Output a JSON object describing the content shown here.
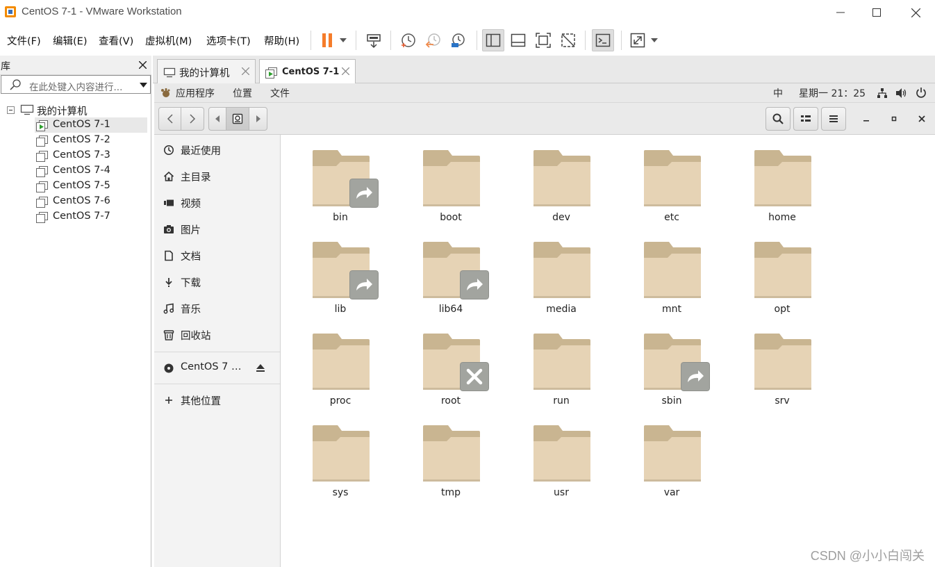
{
  "window": {
    "title": "CentOS 7-1 - VMware Workstation"
  },
  "menu": {
    "items": [
      "文件(F)",
      "编辑(E)",
      "查看(V)",
      "虚拟机(M)",
      "选项卡(T)",
      "帮助(H)"
    ]
  },
  "toolbar": {
    "icons": [
      "pause-icon",
      "dropdown-icon",
      "send-ctrl-alt-del-icon",
      "snapshot-icon",
      "revert-snapshot-icon",
      "snapshot-manager-icon",
      "library-view-icon",
      "thumbnail-view-icon",
      "fullscreen-icon",
      "unity-icon",
      "console-icon",
      "stretch-icon",
      "dropdown-icon"
    ]
  },
  "library": {
    "title": "库",
    "search_placeholder": "在此处键入内容进行...",
    "root": "我的计算机",
    "vms": [
      "CentOS 7-1",
      "CentOS 7-2",
      "CentOS 7-3",
      "CentOS 7-4",
      "CentOS 7-5",
      "CentOS 7-6",
      "CentOS 7-7"
    ],
    "selected": "CentOS 7-1"
  },
  "tabs": [
    {
      "label": "我的计算机",
      "active": false
    },
    {
      "label": "CentOS 7-1",
      "active": true
    }
  ],
  "gnome": {
    "menus": [
      "应用程序",
      "位置",
      "文件"
    ],
    "input_method": "中",
    "clock": "星期一 21：25"
  },
  "sidebar": {
    "places": [
      {
        "label": "最近使用",
        "icon": "recent-icon"
      },
      {
        "label": "主目录",
        "icon": "home-icon"
      },
      {
        "label": "视频",
        "icon": "video-icon"
      },
      {
        "label": "图片",
        "icon": "camera-icon"
      },
      {
        "label": "文档",
        "icon": "document-icon"
      },
      {
        "label": "下载",
        "icon": "download-icon"
      },
      {
        "label": "音乐",
        "icon": "music-icon"
      },
      {
        "label": "回收站",
        "icon": "trash-icon"
      }
    ],
    "device": {
      "label": "CentOS 7 …",
      "icon": "disc-icon"
    },
    "other": {
      "label": "其他位置",
      "icon": "plus-icon"
    }
  },
  "files": [
    {
      "name": "bin",
      "emblem": "symlink"
    },
    {
      "name": "boot",
      "emblem": ""
    },
    {
      "name": "dev",
      "emblem": ""
    },
    {
      "name": "etc",
      "emblem": ""
    },
    {
      "name": "home",
      "emblem": ""
    },
    {
      "name": "lib",
      "emblem": "symlink"
    },
    {
      "name": "lib64",
      "emblem": "symlink"
    },
    {
      "name": "media",
      "emblem": ""
    },
    {
      "name": "mnt",
      "emblem": ""
    },
    {
      "name": "opt",
      "emblem": ""
    },
    {
      "name": "proc",
      "emblem": ""
    },
    {
      "name": "root",
      "emblem": "no-access"
    },
    {
      "name": "run",
      "emblem": ""
    },
    {
      "name": "sbin",
      "emblem": "symlink"
    },
    {
      "name": "srv",
      "emblem": ""
    },
    {
      "name": "sys",
      "emblem": ""
    },
    {
      "name": "tmp",
      "emblem": ""
    },
    {
      "name": "usr",
      "emblem": ""
    },
    {
      "name": "var",
      "emblem": ""
    }
  ],
  "watermark": "CSDN @小小白闯关",
  "colors": {
    "folder_back": "#c9b591",
    "folder_front": "#e6d3b5",
    "pause_orange": "#f57c2a",
    "vmware_orange": "#f38b00"
  }
}
